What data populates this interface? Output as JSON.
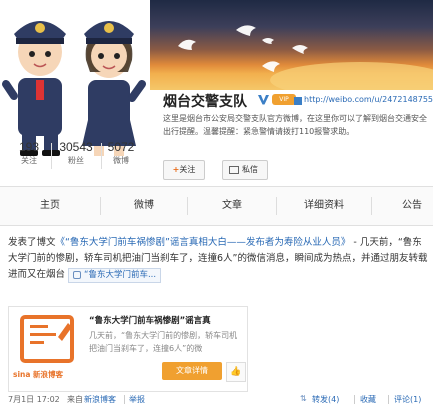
{
  "profile": {
    "name": "烟台交警支队",
    "vip_badge": "VIP",
    "url": "http://weibo.com/u/2472148755",
    "intro": "这里是烟台市公安局交警支队官方微博，在这里你可以了解到烟台交通安全出行提醒。温馨提醒：紧急警情请拨打110报警求助。",
    "stats": [
      {
        "value": "193",
        "label": "关注"
      },
      {
        "value": "30543",
        "label": "粉丝"
      },
      {
        "value": "5072",
        "label": "微博"
      }
    ],
    "follow_label": "关注",
    "message_label": "私信",
    "colors": {
      "accent": "#f0a030",
      "link": "#2a6ab5",
      "verified": "#3b7fc6"
    }
  },
  "tabs": [
    {
      "label": "主页"
    },
    {
      "label": "微博"
    },
    {
      "label": "文章"
    },
    {
      "label": "详细资料"
    },
    {
      "label": "公告"
    }
  ],
  "post": {
    "prefix": "发表了博文",
    "title_link": "《“鲁东大学门前车祸惨剧”谣言真相大白——发布者为寿险从业人员》",
    "body": " - 几天前，“鲁东大学门前的惨剧，轿车司机把油门当刹车了，连撞6人”的微信消息，瞬间成为热点，并通过朋友转载进而又在烟台",
    "link_chip": "“鲁东大学门前车...",
    "card": {
      "title": "“鲁东大学门前车祸惨剧”谣言真",
      "desc": "几天前，“鲁东大学门前的惨剧，轿车司机把油门当刹车了，连撞6人”的微",
      "button": "文章详情",
      "brand": "sina 新浪博客"
    },
    "footer": {
      "date": "7月1日 17:02",
      "from_prefix": "来自",
      "source": "新浪博客",
      "report": "举报",
      "repost": "转发(4)",
      "favorite": "收藏",
      "comment": "评论(1)"
    }
  }
}
